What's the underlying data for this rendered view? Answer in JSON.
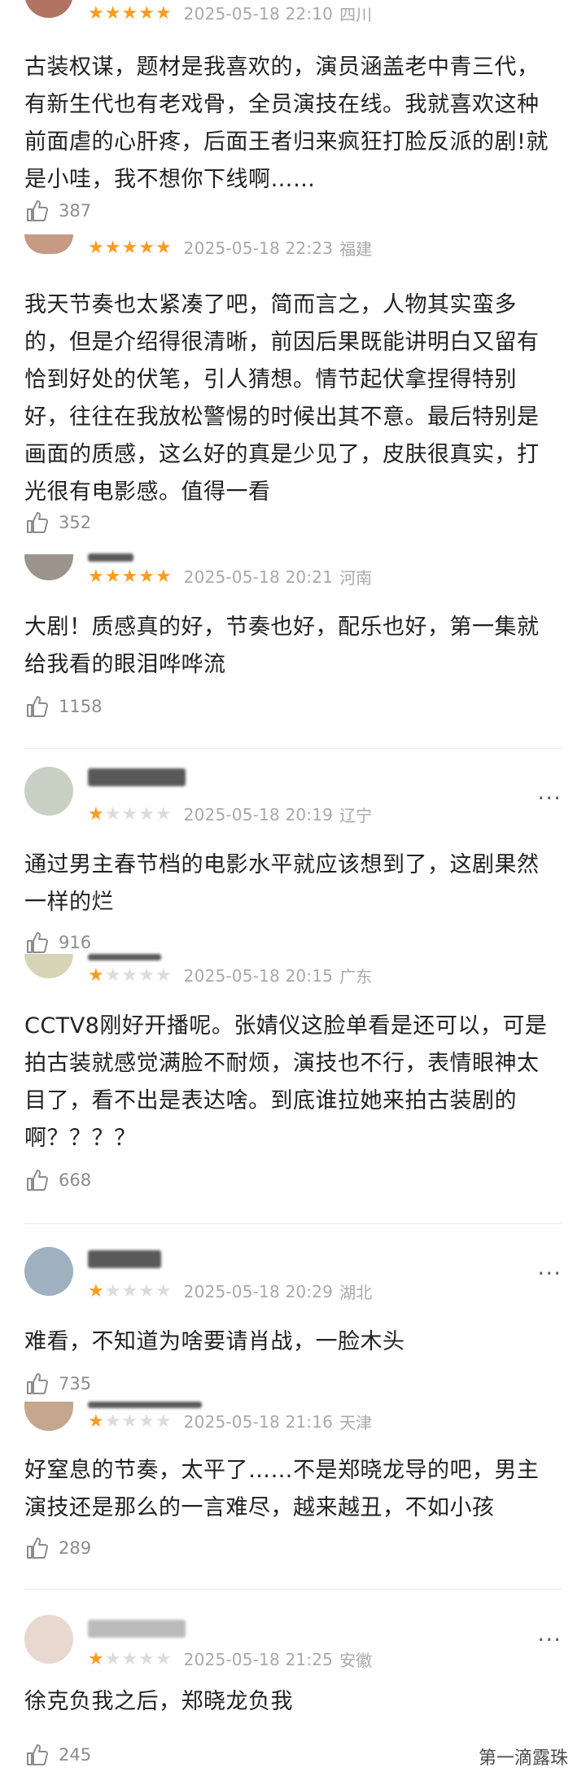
{
  "reviews": [
    {
      "rating": 5,
      "date": "2025-05-18 22:10",
      "location": "四川",
      "text": "古装权谋，题材是我喜欢的，演员涵盖老中青三代，有新生代也有老戏骨，全员演技在线。我就喜欢这种前面虐的心肝疼，后面王者归来疯狂打脸反派的剧!就是小哇，我不想你下线啊……",
      "likes": "387"
    },
    {
      "rating": 5,
      "date": "2025-05-18 22:23",
      "location": "福建",
      "text": "我天节奏也太紧凑了吧，简而言之，人物其实蛮多的，但是介绍得很清晰，前因后果既能讲明白又留有恰到好处的伏笔，引人猜想。情节起伏拿捏得特别好，往往在我放松警惕的时候出其不意。最后特别是画面的质感，这么好的真是少见了，皮肤很真实，打光很有电影感。值得一看",
      "likes": "352"
    },
    {
      "rating": 5,
      "date": "2025-05-18 20:21",
      "location": "河南",
      "text": "大剧！质感真的好，节奏也好，配乐也好，第一集就给我看的眼泪哗哗流",
      "likes": "1158"
    },
    {
      "rating": 1,
      "date": "2025-05-18 20:19",
      "location": "辽宁",
      "text": "通过男主春节档的电影水平就应该想到了，这剧果然一样的烂",
      "likes": "916"
    },
    {
      "rating": 1,
      "date": "2025-05-18 20:15",
      "location": "广东",
      "text": "CCTV8刚好开播呢。张婧仪这脸单看是还可以，可是拍古装就感觉满脸不耐烦，演技也不行，表情眼神太目了，看不出是表达啥。到底谁拉她来拍古装剧的啊？？？？",
      "likes": "668"
    },
    {
      "rating": 1,
      "date": "2025-05-18 20:29",
      "location": "湖北",
      "text": "难看，不知道为啥要请肖战，一脸木头",
      "likes": "735"
    },
    {
      "rating": 1,
      "date": "2025-05-18 21:16",
      "location": "天津",
      "text": "好窒息的节奏，太平了……不是郑晓龙导的吧，男主演技还是那么的一言难尽，越来越丑，不如小孩",
      "likes": "289"
    },
    {
      "rating": 1,
      "date": "2025-05-18 21:25",
      "location": "安徽",
      "text": "徐克负我之后，郑晓龙负我",
      "likes": "245"
    }
  ],
  "more_label": "···",
  "watermark": "第一滴露珠",
  "colors": {
    "star_on": "#ff9b1f",
    "star_off": "#dcdcdc"
  },
  "icons": {
    "like": "thumbs-up-icon",
    "more": "more-options-icon"
  }
}
